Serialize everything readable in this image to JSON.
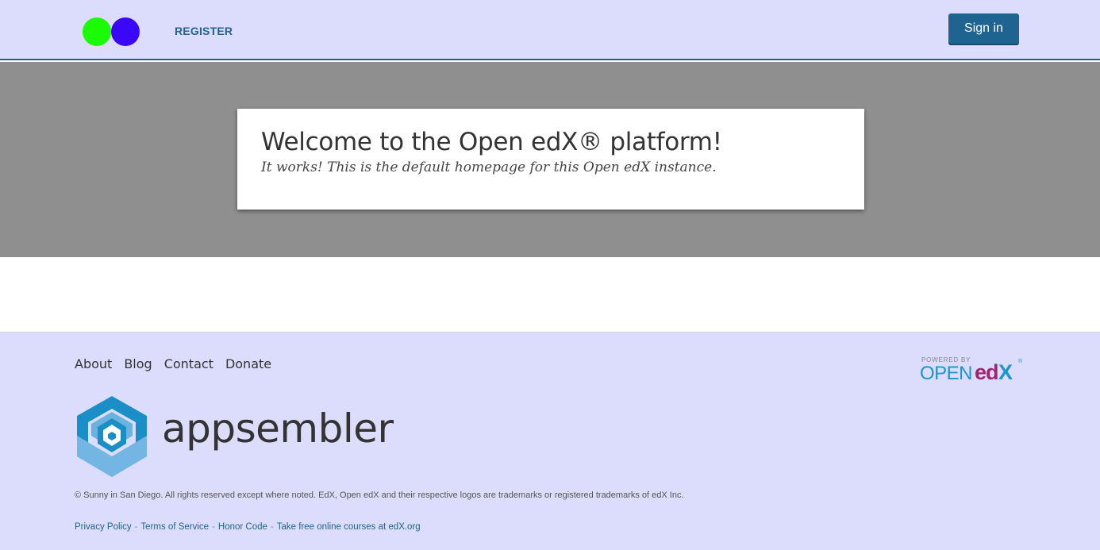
{
  "header": {
    "register_label": "REGISTER",
    "signin_label": "Sign in",
    "logo_colors": [
      "#1bfb06",
      "#3b07f7"
    ]
  },
  "hero": {
    "title": "Welcome to the Open edX® platform!",
    "subtitle": "It works! This is the default homepage for this Open edX instance."
  },
  "footer": {
    "nav": [
      "About",
      "Blog",
      "Contact",
      "Donate"
    ],
    "brand_name": "appsembler",
    "copyright": "© Sunny in San Diego. All rights reserved except where noted. EdX, Open edX and their respective logos are trademarks or registered trademarks of edX Inc.",
    "legal_links": [
      "Privacy Policy",
      "Terms of Service",
      "Honor Code",
      "Take free online courses at edX.org"
    ],
    "powered_by": {
      "line1": "POWERED BY",
      "open": "OPEN",
      "ed": "ed",
      "x": "X",
      "reg": "®"
    }
  },
  "colors": {
    "header_bg": "#dcdcfc",
    "accent": "#1f6491",
    "hero_bg": "#8f8f8f"
  }
}
